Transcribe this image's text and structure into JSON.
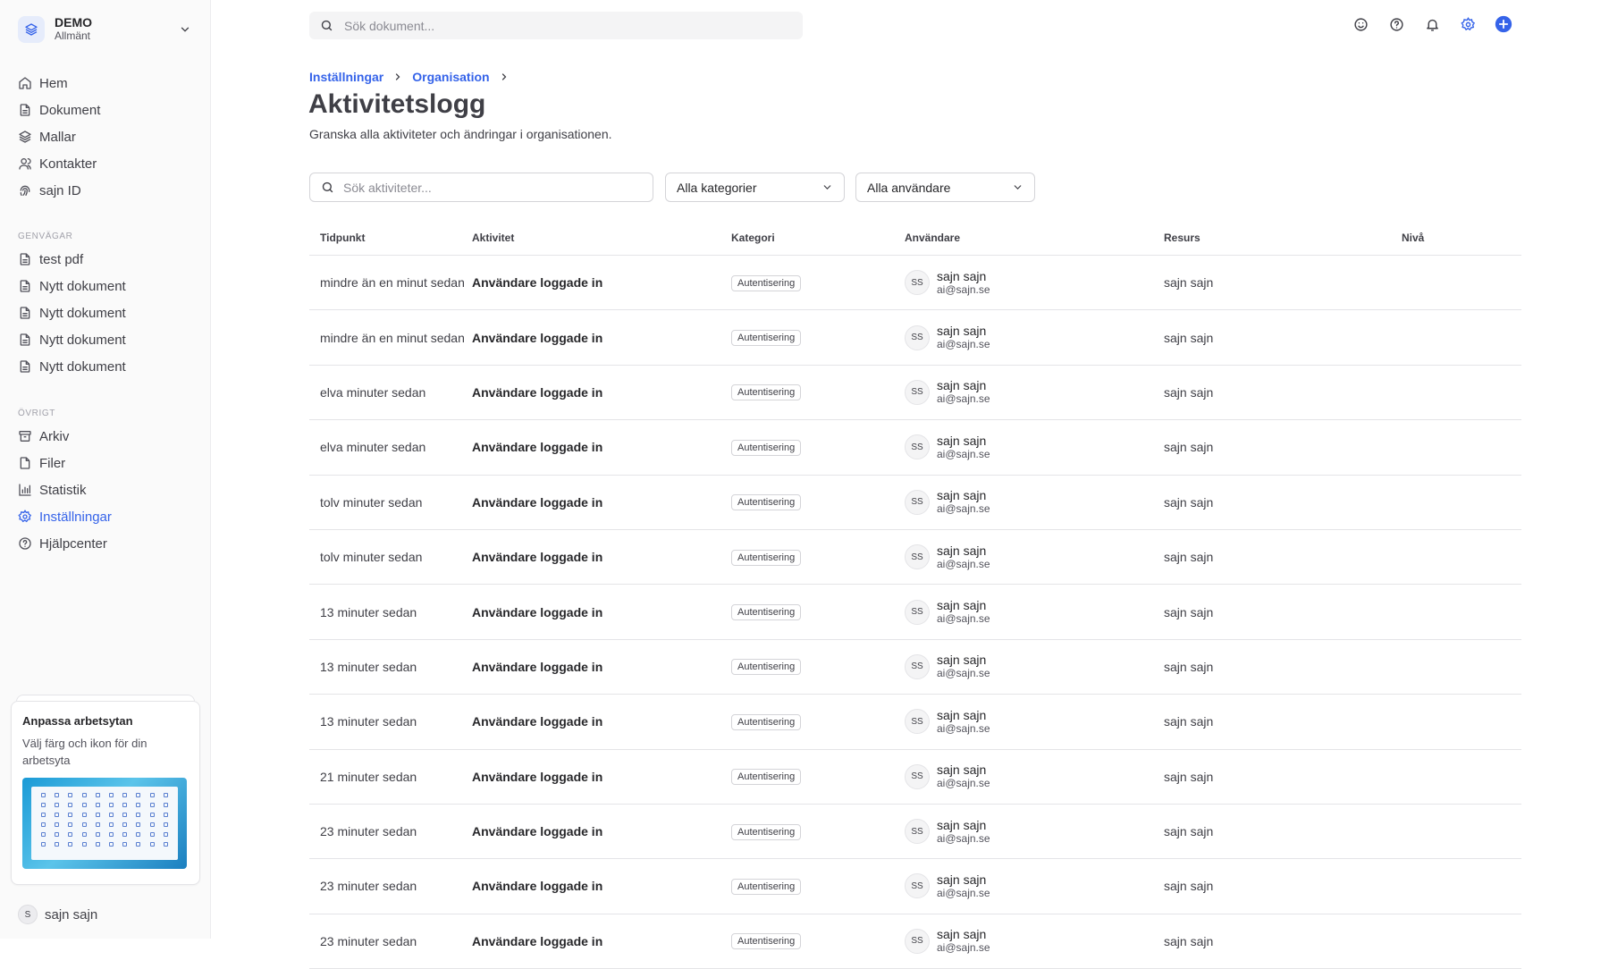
{
  "workspace": {
    "name": "DEMO",
    "subtitle": "Allmänt"
  },
  "nav_main": [
    {
      "label": "Hem",
      "icon": "home-icon"
    },
    {
      "label": "Dokument",
      "icon": "file-icon"
    },
    {
      "label": "Mallar",
      "icon": "layers-icon"
    },
    {
      "label": "Kontakter",
      "icon": "users-icon"
    },
    {
      "label": "sajn ID",
      "icon": "fingerprint-icon"
    }
  ],
  "shortcuts_label": "GENVÄGAR",
  "shortcuts": [
    {
      "label": "test pdf"
    },
    {
      "label": "Nytt dokument"
    },
    {
      "label": "Nytt dokument"
    },
    {
      "label": "Nytt dokument"
    },
    {
      "label": "Nytt dokument"
    }
  ],
  "other_label": "ÖVRIGT",
  "other": [
    {
      "label": "Arkiv",
      "icon": "archive-icon"
    },
    {
      "label": "Filer",
      "icon": "file-icon"
    },
    {
      "label": "Statistik",
      "icon": "chart-icon"
    },
    {
      "label": "Inställningar",
      "icon": "gear-icon",
      "active": true
    },
    {
      "label": "Hjälpcenter",
      "icon": "help-circle-icon"
    }
  ],
  "promo": {
    "title": "Anpassa arbetsytan",
    "description": "Välj färg och ikon för din arbetsyta"
  },
  "current_user": {
    "initials": "S",
    "name": "sajn sajn"
  },
  "topbar": {
    "search_placeholder": "Sök dokument..."
  },
  "breadcrumb": {
    "level1": "Inställningar",
    "level2": "Organisation"
  },
  "page": {
    "title": "Aktivitetslogg",
    "description": "Granska alla aktiviteter och ändringar i organisationen."
  },
  "filters": {
    "search_placeholder": "Sök aktiviteter...",
    "category": "Alla kategorier",
    "user": "Alla användare"
  },
  "table": {
    "headers": {
      "time": "Tidpunkt",
      "activity": "Aktivitet",
      "category": "Kategori",
      "user": "Användare",
      "resource": "Resurs",
      "level": "Nivå"
    },
    "rows": [
      {
        "time": "mindre än en minut sedan",
        "activity": "Användare loggade in",
        "category": "Autentisering",
        "initials": "SS",
        "user": "sajn sajn",
        "email": "ai@sajn.se",
        "resource": "sajn sajn",
        "level": ""
      },
      {
        "time": "mindre än en minut sedan",
        "activity": "Användare loggade in",
        "category": "Autentisering",
        "initials": "SS",
        "user": "sajn sajn",
        "email": "ai@sajn.se",
        "resource": "sajn sajn",
        "level": ""
      },
      {
        "time": "elva minuter sedan",
        "activity": "Användare loggade in",
        "category": "Autentisering",
        "initials": "SS",
        "user": "sajn sajn",
        "email": "ai@sajn.se",
        "resource": "sajn sajn",
        "level": ""
      },
      {
        "time": "elva minuter sedan",
        "activity": "Användare loggade in",
        "category": "Autentisering",
        "initials": "SS",
        "user": "sajn sajn",
        "email": "ai@sajn.se",
        "resource": "sajn sajn",
        "level": ""
      },
      {
        "time": "tolv minuter sedan",
        "activity": "Användare loggade in",
        "category": "Autentisering",
        "initials": "SS",
        "user": "sajn sajn",
        "email": "ai@sajn.se",
        "resource": "sajn sajn",
        "level": ""
      },
      {
        "time": "tolv minuter sedan",
        "activity": "Användare loggade in",
        "category": "Autentisering",
        "initials": "SS",
        "user": "sajn sajn",
        "email": "ai@sajn.se",
        "resource": "sajn sajn",
        "level": ""
      },
      {
        "time": "13 minuter sedan",
        "activity": "Användare loggade in",
        "category": "Autentisering",
        "initials": "SS",
        "user": "sajn sajn",
        "email": "ai@sajn.se",
        "resource": "sajn sajn",
        "level": ""
      },
      {
        "time": "13 minuter sedan",
        "activity": "Användare loggade in",
        "category": "Autentisering",
        "initials": "SS",
        "user": "sajn sajn",
        "email": "ai@sajn.se",
        "resource": "sajn sajn",
        "level": ""
      },
      {
        "time": "13 minuter sedan",
        "activity": "Användare loggade in",
        "category": "Autentisering",
        "initials": "SS",
        "user": "sajn sajn",
        "email": "ai@sajn.se",
        "resource": "sajn sajn",
        "level": ""
      },
      {
        "time": "21 minuter sedan",
        "activity": "Användare loggade in",
        "category": "Autentisering",
        "initials": "SS",
        "user": "sajn sajn",
        "email": "ai@sajn.se",
        "resource": "sajn sajn",
        "level": ""
      },
      {
        "time": "23 minuter sedan",
        "activity": "Användare loggade in",
        "category": "Autentisering",
        "initials": "SS",
        "user": "sajn sajn",
        "email": "ai@sajn.se",
        "resource": "sajn sajn",
        "level": ""
      },
      {
        "time": "23 minuter sedan",
        "activity": "Användare loggade in",
        "category": "Autentisering",
        "initials": "SS",
        "user": "sajn sajn",
        "email": "ai@sajn.se",
        "resource": "sajn sajn",
        "level": ""
      },
      {
        "time": "23 minuter sedan",
        "activity": "Användare loggade in",
        "category": "Autentisering",
        "initials": "SS",
        "user": "sajn sajn",
        "email": "ai@sajn.se",
        "resource": "sajn sajn",
        "level": ""
      }
    ]
  },
  "colors": {
    "accent": "#3563e9",
    "text": "#27272a",
    "muted": "#52525b",
    "border": "#e4e4e7",
    "sidebar_bg": "#fafafa"
  }
}
